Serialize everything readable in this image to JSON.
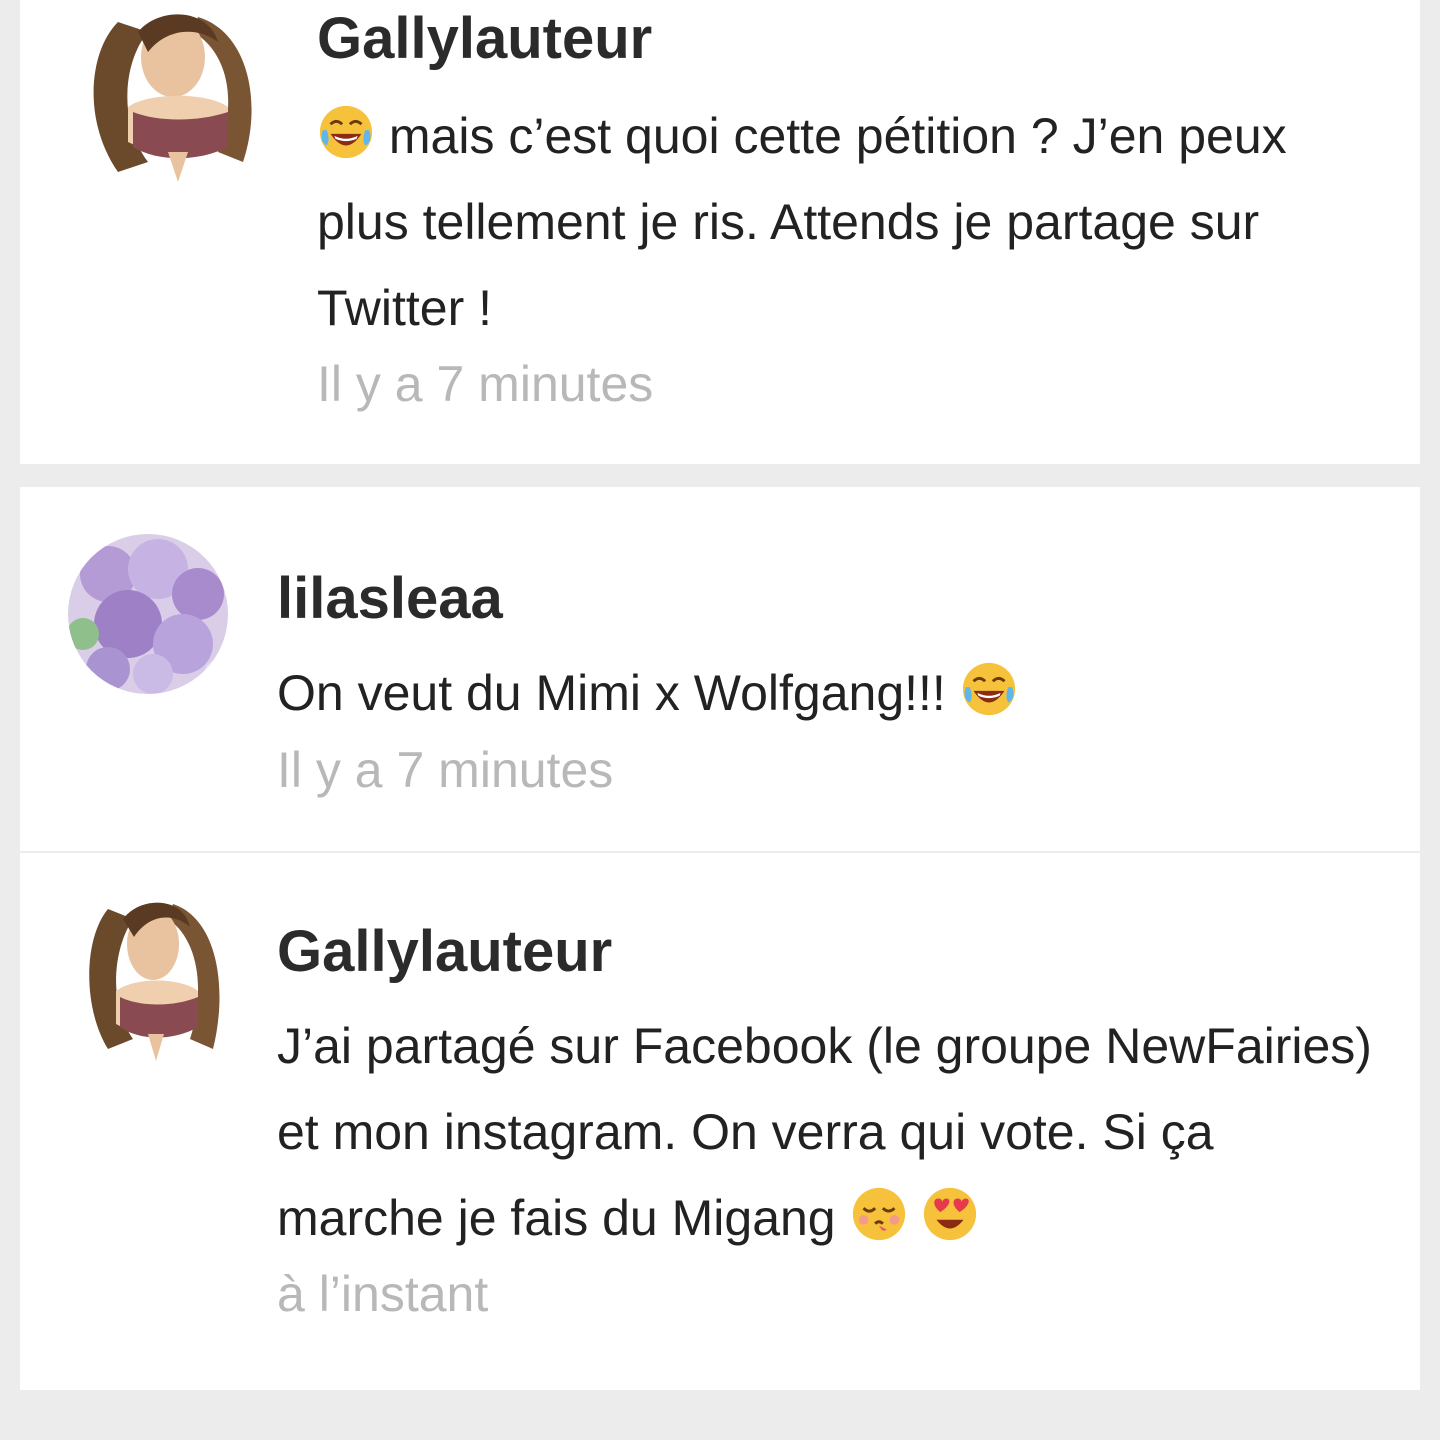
{
  "comments": [
    {
      "author": "Gallylauteur",
      "emoji_lead": "tears-of-joy-emoji",
      "text": " mais c’est quoi cette pétition ? J’en peux plus tellement je ris. Attends je partage sur Twitter !",
      "time": "Il y a 7 minutes"
    },
    {
      "author": "lilasleaa",
      "text": "On veut du Mimi x Wolfgang!!! ",
      "emoji_trail": "tears-of-joy-emoji",
      "time": "Il y a 7 minutes"
    },
    {
      "author": "Gallylauteur",
      "text": "J’ai partagé sur Facebook  (le groupe NewFairies) et mon instagram. On verra qui vote. Si ça marche je fais du Migang ",
      "emoji_trail": [
        "kissing-face-emoji",
        "heart-eyes-emoji"
      ],
      "time": "à l’instant"
    }
  ],
  "colors": {
    "background": "#ececec",
    "card": "#ffffff",
    "author": "#2b2b2b",
    "timestamp": "#b8b8b8"
  }
}
